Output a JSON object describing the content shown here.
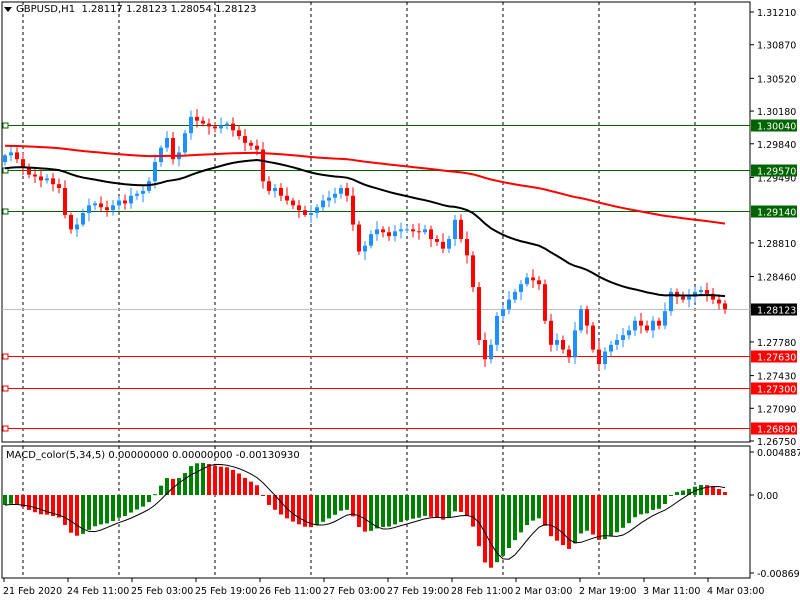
{
  "header": {
    "symbol": "GBPUSD,H1",
    "open": "1.28117",
    "high": "1.28123",
    "low": "1.28054",
    "close": "1.28123"
  },
  "macd_header": {
    "name": "MACD_color(5,34,5)",
    "v1": "0.00000000",
    "v2": "0.00000000",
    "v3": "-0.00130930"
  },
  "colors": {
    "bull": "#1e90ff",
    "bear": "#ff0000",
    "ma_fast": "#000000",
    "ma_slow": "#ff0000",
    "support_line": "#ff0000",
    "resistance_line": "#006400",
    "hist_up": "#008000",
    "hist_down": "#ff0000"
  },
  "chart_data": {
    "type": "candlestick",
    "symbol": "GBPUSD",
    "timeframe": "H1",
    "price_range": [
      1.2675,
      1.3121
    ],
    "price_ticks": [
      "1.31210",
      "1.30870",
      "1.30520",
      "1.30180",
      "1.29840",
      "1.29490",
      "1.28810",
      "1.28460",
      "1.27780",
      "1.27430",
      "1.27090",
      "1.26750"
    ],
    "time_labels": [
      "21 Feb 2020",
      "24 Feb 11:00",
      "25 Feb 03:00",
      "25 Feb 19:00",
      "26 Feb 11:00",
      "27 Feb 03:00",
      "27 Feb 19:00",
      "28 Feb 11:00",
      "2 Mar 03:00",
      "2 Mar 19:00",
      "3 Mar 11:00",
      "4 Mar 03:00"
    ],
    "closes": [
      1.2972,
      1.2975,
      1.2968,
      1.296,
      1.2952,
      1.295,
      1.2946,
      1.2948,
      1.2942,
      1.2938,
      1.291,
      1.2895,
      1.29,
      1.2912,
      1.292,
      1.2922,
      1.2918,
      1.2915,
      1.292,
      1.2925,
      1.2922,
      1.293,
      1.2932,
      1.2935,
      1.2945,
      1.2965,
      1.298,
      1.299,
      1.2968,
      1.2975,
      1.2995,
      1.3012,
      1.3008,
      1.3005,
      1.3002,
      1.3,
      1.3003,
      1.3005,
      1.2998,
      1.2992,
      1.2985,
      1.2982,
      1.2978,
      1.2945,
      1.2935,
      1.2938,
      1.293,
      1.2925,
      1.292,
      1.2915,
      1.291,
      1.2912,
      1.2918,
      1.2925,
      1.2928,
      1.2932,
      1.2938,
      1.293,
      1.29,
      1.2872,
      1.2878,
      1.289,
      1.2895,
      1.2892,
      1.2888,
      1.2893,
      1.2895,
      1.2895,
      1.2893,
      1.2892,
      1.2895,
      1.2885,
      1.2882,
      1.2875,
      1.2885,
      1.2905,
      1.2885,
      1.2868,
      1.2835,
      1.278,
      1.276,
      1.2775,
      1.2805,
      1.2812,
      1.2822,
      1.283,
      1.2838,
      1.2845,
      1.2842,
      1.2838,
      1.28,
      1.2775,
      1.278,
      1.277,
      1.2762,
      1.279,
      1.2812,
      1.2795,
      1.277,
      1.2755,
      1.2768,
      1.2775,
      1.278,
      1.2785,
      1.279,
      1.28,
      1.2795,
      1.279,
      1.28,
      1.2795,
      1.281,
      1.283,
      1.2825,
      1.2822,
      1.2825,
      1.283,
      1.2832,
      1.2828,
      1.2822,
      1.2818,
      1.2812
    ],
    "first_open": 1.2965,
    "ma_fast_seed": 1.2958,
    "ma_fast_period": 50,
    "ma_slow_seed": 1.2982,
    "ma_slow_period": 200,
    "levels": [
      {
        "price": 1.3004,
        "label": "1.30040",
        "kind": "resistance"
      },
      {
        "price": 1.2957,
        "label": "1.29570",
        "kind": "resistance"
      },
      {
        "price": 1.2914,
        "label": "1.29140",
        "kind": "resistance"
      },
      {
        "price": 1.2763,
        "label": "1.27630",
        "kind": "support"
      },
      {
        "price": 1.273,
        "label": "1.27300",
        "kind": "support"
      },
      {
        "price": 1.2689,
        "label": "1.26890",
        "kind": "support"
      }
    ],
    "current_price": {
      "price": 1.28123,
      "label": "1.28123"
    },
    "macd": {
      "fast": 5,
      "slow": 34,
      "signal": 5,
      "range": [
        -0.008699,
        0.0048871
      ],
      "ticks": [
        "0.0048871",
        "0.00",
        "-0.008699"
      ]
    }
  }
}
